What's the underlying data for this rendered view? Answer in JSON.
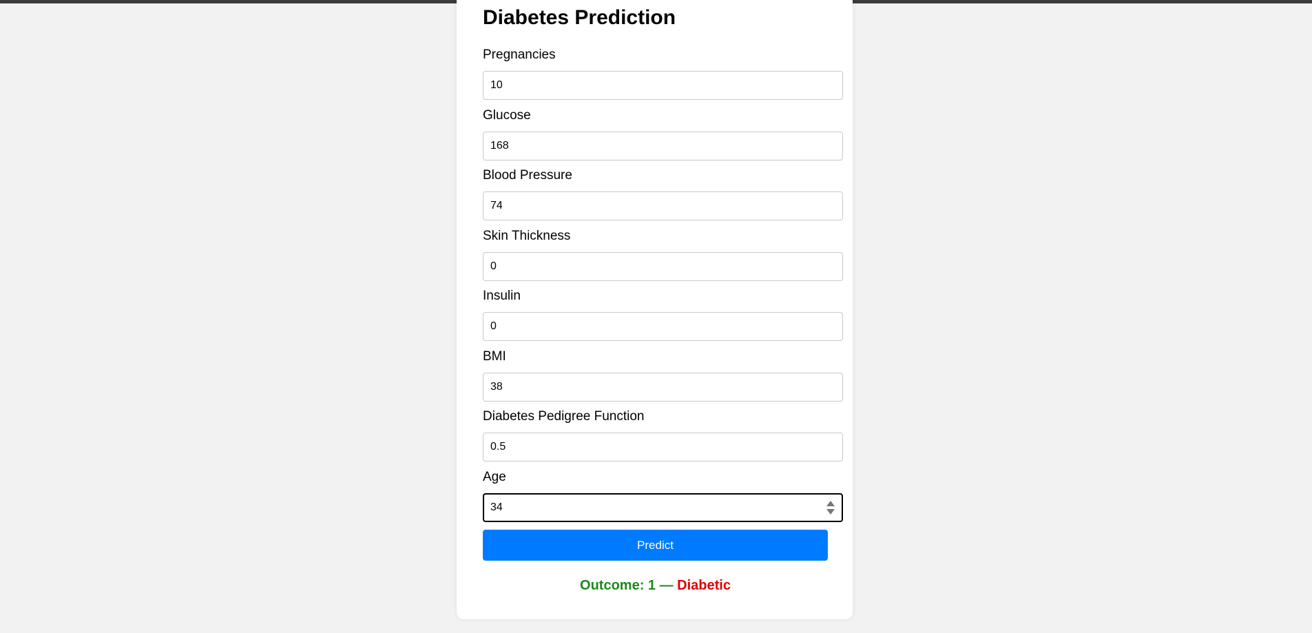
{
  "page": {
    "title": "Diabetes Prediction"
  },
  "form": {
    "fields": [
      {
        "label": "Pregnancies",
        "value": "10"
      },
      {
        "label": "Glucose",
        "value": "168"
      },
      {
        "label": "Blood Pressure",
        "value": "74"
      },
      {
        "label": "Skin Thickness",
        "value": "0"
      },
      {
        "label": "Insulin",
        "value": "0"
      },
      {
        "label": "BMI",
        "value": "38"
      },
      {
        "label": "Diabetes Pedigree Function",
        "value": "0.5"
      },
      {
        "label": "Age",
        "value": "34"
      }
    ],
    "submit_label": "Predict"
  },
  "result": {
    "prefix": "Outcome: 1 —",
    "verdict": "Diabetic",
    "prefix_color": "#1a8a1a",
    "verdict_color": "#e00000"
  },
  "colors": {
    "accent": "#007bff",
    "background": "#f2f2f2"
  },
  "icons": {
    "number_spinner": "spinner-arrows-icon"
  }
}
